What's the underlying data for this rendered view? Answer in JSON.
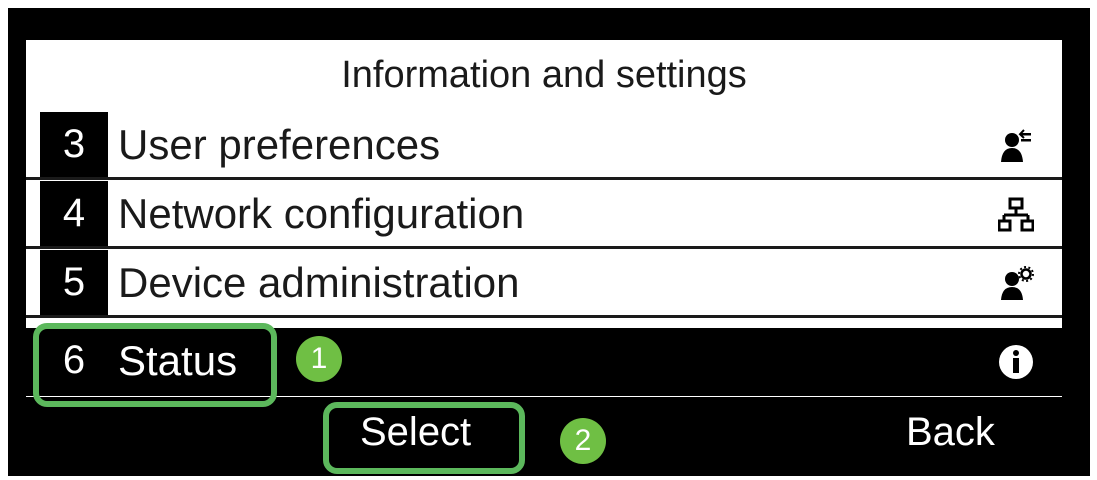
{
  "screen": {
    "title": "Information and settings",
    "items": [
      {
        "number": "3",
        "label": "User preferences",
        "icon": "user-preferences-icon"
      },
      {
        "number": "4",
        "label": "Network configuration",
        "icon": "network-icon"
      },
      {
        "number": "5",
        "label": "Device administration",
        "icon": "user-gear-icon"
      },
      {
        "number": "6",
        "label": "Status",
        "icon": "info-icon",
        "selected": true
      }
    ]
  },
  "softkeys": {
    "select_label": "Select",
    "back_label": "Back"
  },
  "callouts": {
    "first": "1",
    "second": "2"
  },
  "colors": {
    "callout_green": "#6fbf44",
    "bezel": "#000000",
    "screen_bg": "#ffffff"
  }
}
